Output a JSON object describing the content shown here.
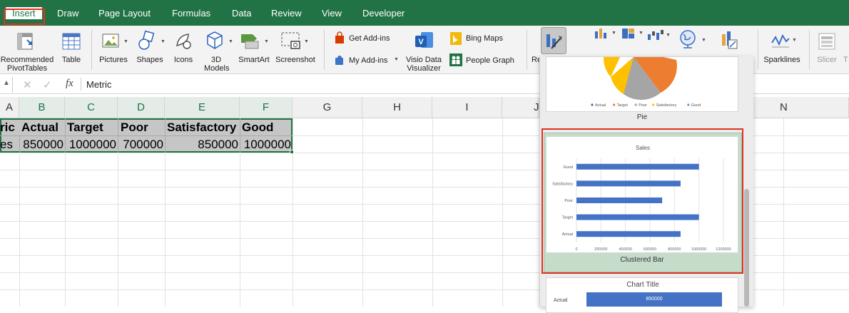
{
  "tabs": [
    "Insert",
    "Draw",
    "Page Layout",
    "Formulas",
    "Data",
    "Review",
    "View",
    "Developer"
  ],
  "ribbon": {
    "recommended_pivot": "Recommended PivotTables",
    "table": "Table",
    "pictures": "Pictures",
    "shapes": "Shapes",
    "icons": "Icons",
    "models_3d": "3D Models",
    "smartart": "SmartArt",
    "screenshot": "Screenshot",
    "get_addins": "Get Add-ins",
    "my_addins": "My Add-ins",
    "visio": "Visio Data Visualizer",
    "bing_maps": "Bing Maps",
    "people_graph": "People Graph",
    "recommended_charts_partial": "Re",
    "sparklines": "Sparklines",
    "slicer": "Slicer",
    "timeline_partial": "T"
  },
  "formula_bar": {
    "cell_ref_partial": "",
    "fx": "fx",
    "content": "Metric"
  },
  "columns": [
    "A",
    "B",
    "C",
    "D",
    "E",
    "F",
    "G",
    "H",
    "I",
    "J",
    "N"
  ],
  "sheet": {
    "header_row": [
      "ric",
      "Actual",
      "Target",
      "Poor",
      "Satisfactory",
      "Good"
    ],
    "data_row": [
      "es",
      "850000",
      "1000000",
      "700000",
      "850000",
      "1000000"
    ]
  },
  "gallery": {
    "pie_label": "Pie",
    "pie_legend": [
      "Actual",
      "Target",
      "Poor",
      "Satisfactory",
      "Good"
    ],
    "bar_label": "Clustered Bar",
    "third_title": "Chart Title",
    "third_cat": "Actual",
    "third_value": "850000"
  },
  "chart_data": [
    {
      "type": "bar",
      "orientation": "horizontal",
      "title": "Sales",
      "categories": [
        "Good",
        "Satisfactory",
        "Poor",
        "Target",
        "Actual"
      ],
      "values": [
        1000000,
        850000,
        700000,
        1000000,
        850000
      ],
      "xlim": [
        0,
        1200000
      ],
      "xticks": [
        "0",
        "200000",
        "400000",
        "600000",
        "800000",
        "1000000",
        "1200000"
      ],
      "color": "#4472c4",
      "grid": true
    }
  ],
  "colors": {
    "excel_green": "#217346",
    "highlight": "#e0311f",
    "bar": "#4472c4",
    "pie_slices": [
      "#4472c4",
      "#ed7d31",
      "#a5a5a5",
      "#ffc000",
      "#5b9bd5"
    ]
  }
}
